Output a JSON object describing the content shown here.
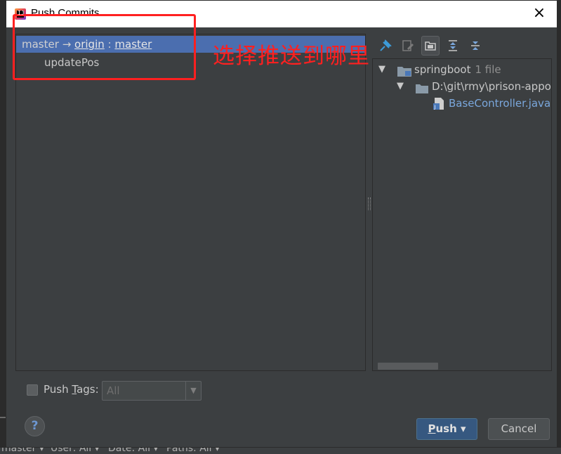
{
  "window": {
    "title": "Push Commits",
    "close_glyph": "×"
  },
  "commits_panel": {
    "local_branch": "master",
    "arrow": "→",
    "remote": "origin",
    "separator": ":",
    "remote_branch": "master",
    "commits": [
      "updatePos"
    ]
  },
  "annotation": {
    "text": "选择推送到哪里",
    "color": "#ff2020"
  },
  "toolbar": {
    "icons": [
      "pin-icon",
      "edit-source-icon",
      "group-by-directory-icon",
      "expand-all-icon",
      "collapse-all-icon"
    ]
  },
  "file_tree": {
    "root": {
      "label": "springboot",
      "count": "1 file"
    },
    "folder": {
      "label": "D:\\git\\rmy\\prison-appo"
    },
    "file": {
      "label": "BaseController.java"
    }
  },
  "push_tags": {
    "label_prefix": "Push ",
    "label_mnemonic": "T",
    "label_suffix": "ags:",
    "selected": "All",
    "checked": false
  },
  "buttons": {
    "help": "?",
    "push_mnemonic": "P",
    "push_rest": "ush",
    "push_dropdown": "▾",
    "cancel": "Cancel"
  },
  "statusbar": {
    "items": [
      "master ▾",
      "User: All ▾",
      "Date: All ▾",
      "Paths: All ▾"
    ]
  },
  "colors": {
    "accent": "#4b6eaf",
    "primary_button": "#365880",
    "background": "#3c3f41"
  }
}
